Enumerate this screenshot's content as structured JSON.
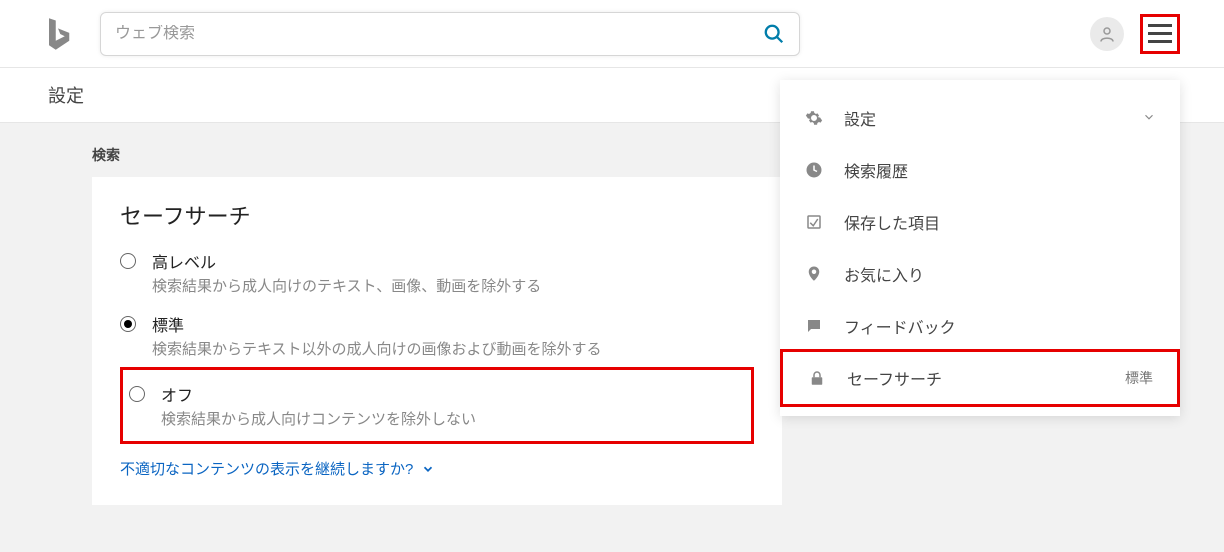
{
  "header": {
    "search_placeholder": "ウェブ検索"
  },
  "page": {
    "title": "設定",
    "section_title": "検索",
    "card_title": "セーフサーチ",
    "disclose_link": "不適切なコンテンツの表示を継続しますか?"
  },
  "safesearch_options": [
    {
      "label": "高レベル",
      "desc": "検索結果から成人向けのテキスト、画像、動画を除外する",
      "checked": false,
      "highlight": false
    },
    {
      "label": "標準",
      "desc": "検索結果からテキスト以外の成人向けの画像および動画を除外する",
      "checked": true,
      "highlight": false
    },
    {
      "label": "オフ",
      "desc": "検索結果から成人向けコンテンツを除外しない",
      "checked": false,
      "highlight": true
    }
  ],
  "menu": [
    {
      "icon": "gear-icon",
      "label": "設定",
      "value": "",
      "chevron": true,
      "highlight": false
    },
    {
      "icon": "history-icon",
      "label": "検索履歴",
      "value": "",
      "chevron": false,
      "highlight": false
    },
    {
      "icon": "bookmark-icon",
      "label": "保存した項目",
      "value": "",
      "chevron": false,
      "highlight": false
    },
    {
      "icon": "heart-icon",
      "label": "お気に入り",
      "value": "",
      "chevron": false,
      "highlight": false
    },
    {
      "icon": "feedback-icon",
      "label": "フィードバック",
      "value": "",
      "chevron": false,
      "highlight": false
    },
    {
      "icon": "lock-icon",
      "label": "セーフサーチ",
      "value": "標準",
      "chevron": false,
      "highlight": true
    }
  ]
}
